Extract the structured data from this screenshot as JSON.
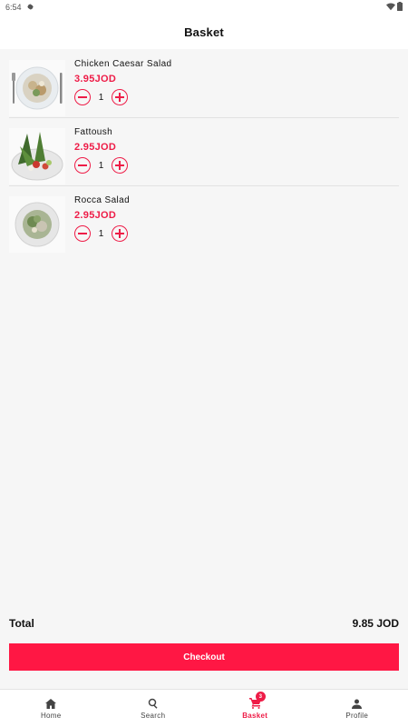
{
  "status_bar": {
    "time": "6:54",
    "icons": [
      "gear-icon",
      "wifi-icon",
      "battery-icon"
    ]
  },
  "header": {
    "title": "Basket"
  },
  "basket": {
    "items": [
      {
        "name": "Chicken Caesar Salad",
        "price": "3.95JOD",
        "quantity": "1",
        "image": "chicken-caesar-salad-photo"
      },
      {
        "name": "Fattoush",
        "price": "2.95JOD",
        "quantity": "1",
        "image": "fattoush-photo"
      },
      {
        "name": "Rocca Salad",
        "price": "2.95JOD",
        "quantity": "1",
        "image": "rocca-salad-photo"
      }
    ],
    "decrement_icon": "minus-circle-icon",
    "increment_icon": "plus-circle-icon"
  },
  "summary": {
    "total_label": "Total",
    "total_value": "9.85 JOD"
  },
  "checkout": {
    "label": "Checkout"
  },
  "nav": {
    "items": [
      {
        "label": "Home",
        "icon": "home-icon"
      },
      {
        "label": "Search",
        "icon": "search-icon"
      },
      {
        "label": "Basket",
        "icon": "cart-icon",
        "badge": "3"
      },
      {
        "label": "Profile",
        "icon": "person-icon"
      }
    ],
    "active": "Basket"
  },
  "colors": {
    "accent": "#ee1c47",
    "button": "#ff1744",
    "background": "#f6f6f6"
  }
}
